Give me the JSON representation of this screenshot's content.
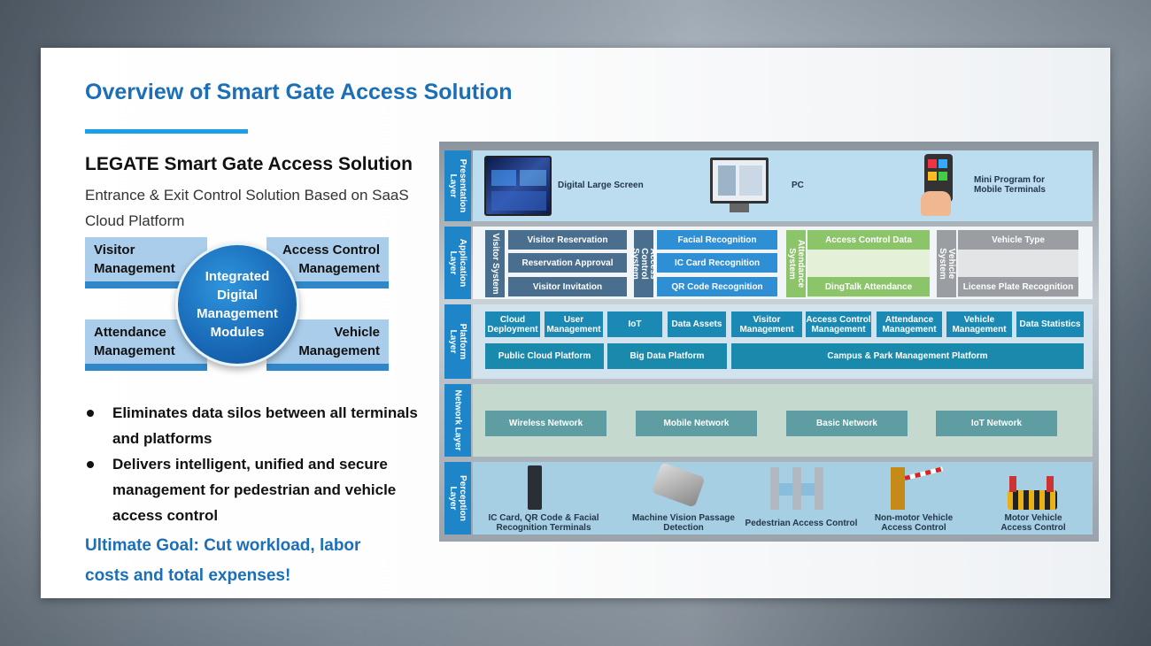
{
  "title": "Overview of Smart Gate Access Solution",
  "subtitle": "LEGATE Smart Gate Access Solution",
  "description": "Entrance & Exit Control Solution Based on SaaS Cloud Platform",
  "modules": {
    "center": "Integrated Digital Management Modules",
    "visitor": "Visitor Management",
    "access_control": "Access Control Management",
    "attendance": "Attendance Management",
    "vehicle": "Vehicle Management"
  },
  "bullets": [
    "Eliminates data silos between all terminals and platforms",
    "Delivers intelligent, unified and secure management for pedestrian and vehicle access control"
  ],
  "goal": "Ultimate Goal: Cut workload, labor costs and total expenses!",
  "diagram": {
    "presentation": {
      "tab": "Presentation Layer",
      "items": [
        "Digital Large Screen",
        "PC",
        "Mini Program for Mobile Terminals"
      ]
    },
    "application": {
      "tab": "Application Layer",
      "visitor_system": "Visitor System",
      "visitor_items": [
        "Visitor Reservation",
        "Reservation Approval",
        "Visitor Invitation"
      ],
      "access_system": "Access Control System",
      "access_items": [
        "Facial Recognition",
        "IC Card Recognition",
        "QR Code Recognition"
      ],
      "attendance_system": "Attendance System",
      "attendance_items": [
        "Access Control Data",
        "DingTalk Attendance"
      ],
      "vehicle_system": "Vehicle System",
      "vehicle_items": [
        "Vehicle Type",
        "License Plate Recognition"
      ]
    },
    "platform": {
      "tab": "Platform Layer",
      "row1": [
        "Cloud Deployment",
        "User Management",
        "IoT",
        "Data Assets",
        "Visitor Management",
        "Access Control Management",
        "Attendance Management",
        "Vehicle Management",
        "Data Statistics"
      ],
      "row2": [
        "Public Cloud Platform",
        "Big Data Platform",
        "Campus & Park Management Platform"
      ]
    },
    "network": {
      "tab": "Network Layer",
      "items": [
        "Wireless Network",
        "Mobile Network",
        "Basic Network",
        "IoT Network"
      ]
    },
    "perception": {
      "tab": "Perception Layer",
      "items": [
        "IC Card, QR Code & Facial Recognition Terminals",
        "Machine Vision Passage Detection",
        "Pedestrian Access Control",
        "Non-motor Vehicle Access Control",
        "Motor Vehicle Access Control"
      ]
    }
  }
}
